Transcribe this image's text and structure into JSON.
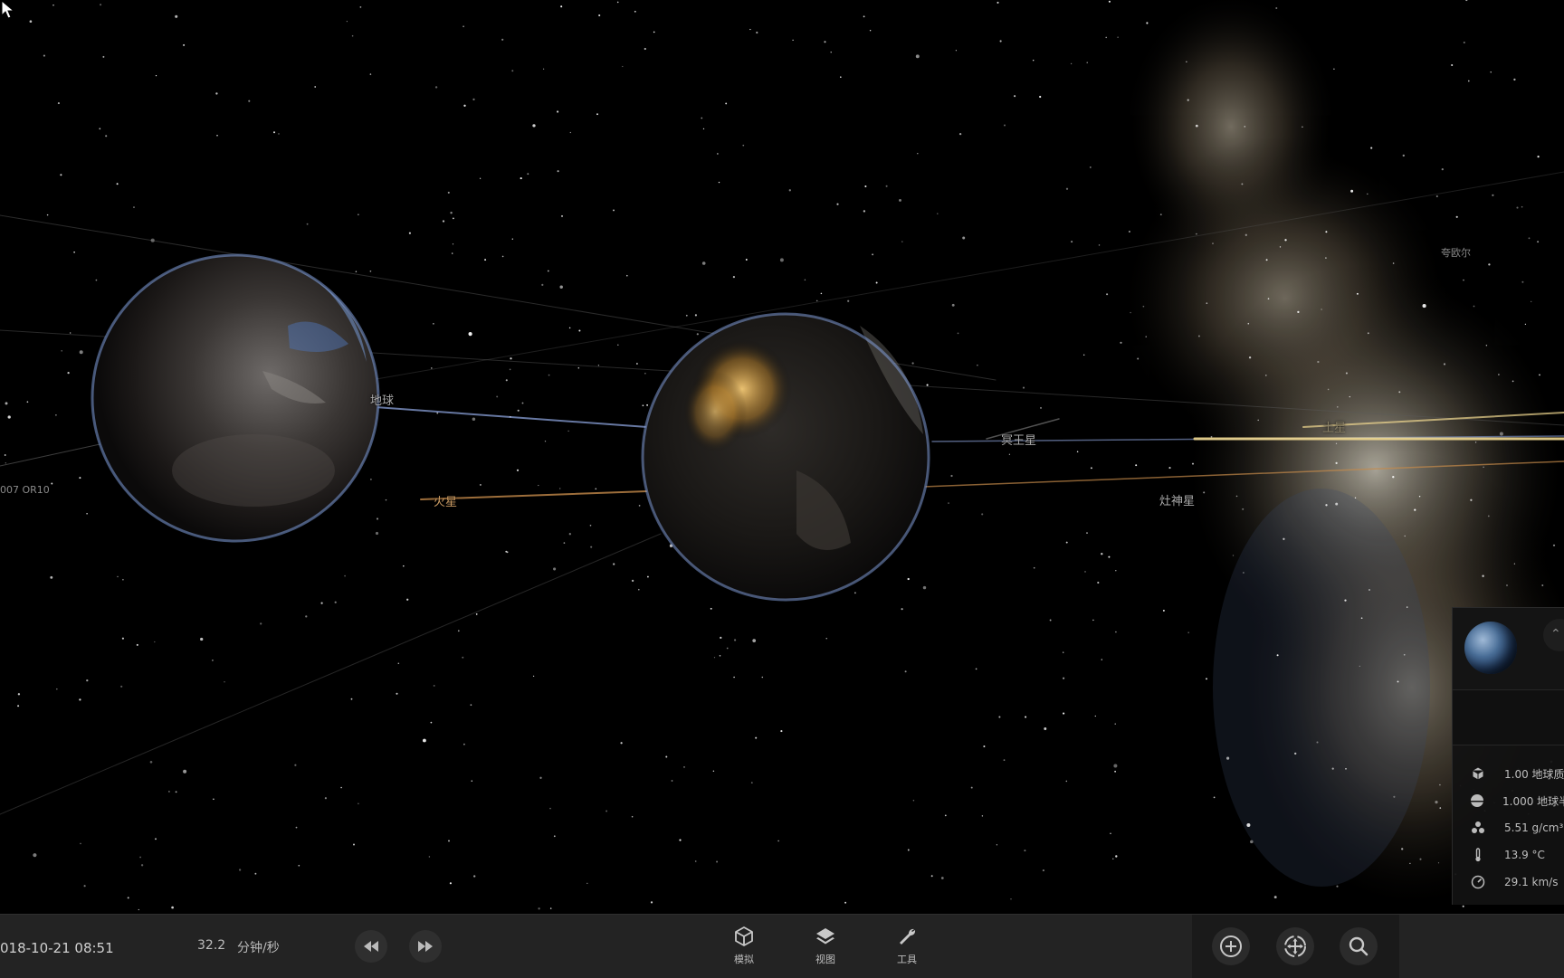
{
  "scene": {
    "labels": {
      "earth_left": "地球",
      "mars": "火星",
      "pluto": "冥王星",
      "saturn": "土星",
      "ceres": "灶神星",
      "kuiper": "夸欧尔",
      "asteroid": "007 OR10"
    },
    "colors": {
      "orbit_blue": "#8aa0d8",
      "orbit_orange": "#c58a4a",
      "orbit_gold": "#f0d890"
    }
  },
  "info_panel": {
    "thumbnail": "earth-thumbnail",
    "collapse_icon": "chevron-up-icon",
    "rows": [
      {
        "icon": "cube-icon",
        "value": "1.00 地球质"
      },
      {
        "icon": "half-circle-icon",
        "value": "1.000 地球半"
      },
      {
        "icon": "density-icon",
        "value": "5.51 g/cm³"
      },
      {
        "icon": "thermometer-icon",
        "value": "13.9 °C"
      },
      {
        "icon": "speedometer-icon",
        "value": "29.1 km/s"
      }
    ]
  },
  "bottom_bar": {
    "datetime": "018-10-21 08:51",
    "rate_value": "32.2",
    "rate_unit": "分钟/秒",
    "rewind_icon": "rewind-icon",
    "forward_icon": "fast-forward-icon",
    "tools": [
      {
        "icon": "cube-icon",
        "label": "模拟"
      },
      {
        "icon": "layers-icon",
        "label": "视图"
      },
      {
        "icon": "wrench-icon",
        "label": "工具"
      }
    ],
    "nav": [
      {
        "icon": "add-circle-icon"
      },
      {
        "icon": "recenter-icon"
      },
      {
        "icon": "search-icon"
      }
    ]
  }
}
